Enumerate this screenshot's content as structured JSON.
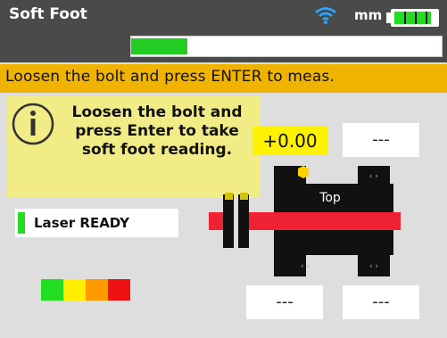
{
  "header": {
    "title": "Soft Foot",
    "units": "mm",
    "progress_fraction": 0.18,
    "wifi_icon": "wifi-icon",
    "battery_icon": "battery-icon",
    "battery_level": 0.9
  },
  "instruction": "Loosen the bolt and press ENTER to meas.",
  "hint": {
    "icon": "info-icon",
    "text": "Loosen the bolt and press Enter to take soft foot reading."
  },
  "measurement": {
    "current_value": "+0.00",
    "top_right": "---",
    "bottom_left": "---",
    "bottom_right": "---"
  },
  "machine": {
    "top_label": "Top",
    "bracket_symbol": "‹ ›"
  },
  "laser": {
    "status": "Laser READY"
  },
  "colors": {
    "titlebar": "#4a4a4a",
    "instruction_bg": "#f0b400",
    "hint_bg": "#f2ec86",
    "value_highlight": "#fff200",
    "progress": "#22cc22",
    "level_segments": [
      "#22dd22",
      "#ffee00",
      "#ff9900",
      "#ee1111"
    ]
  }
}
